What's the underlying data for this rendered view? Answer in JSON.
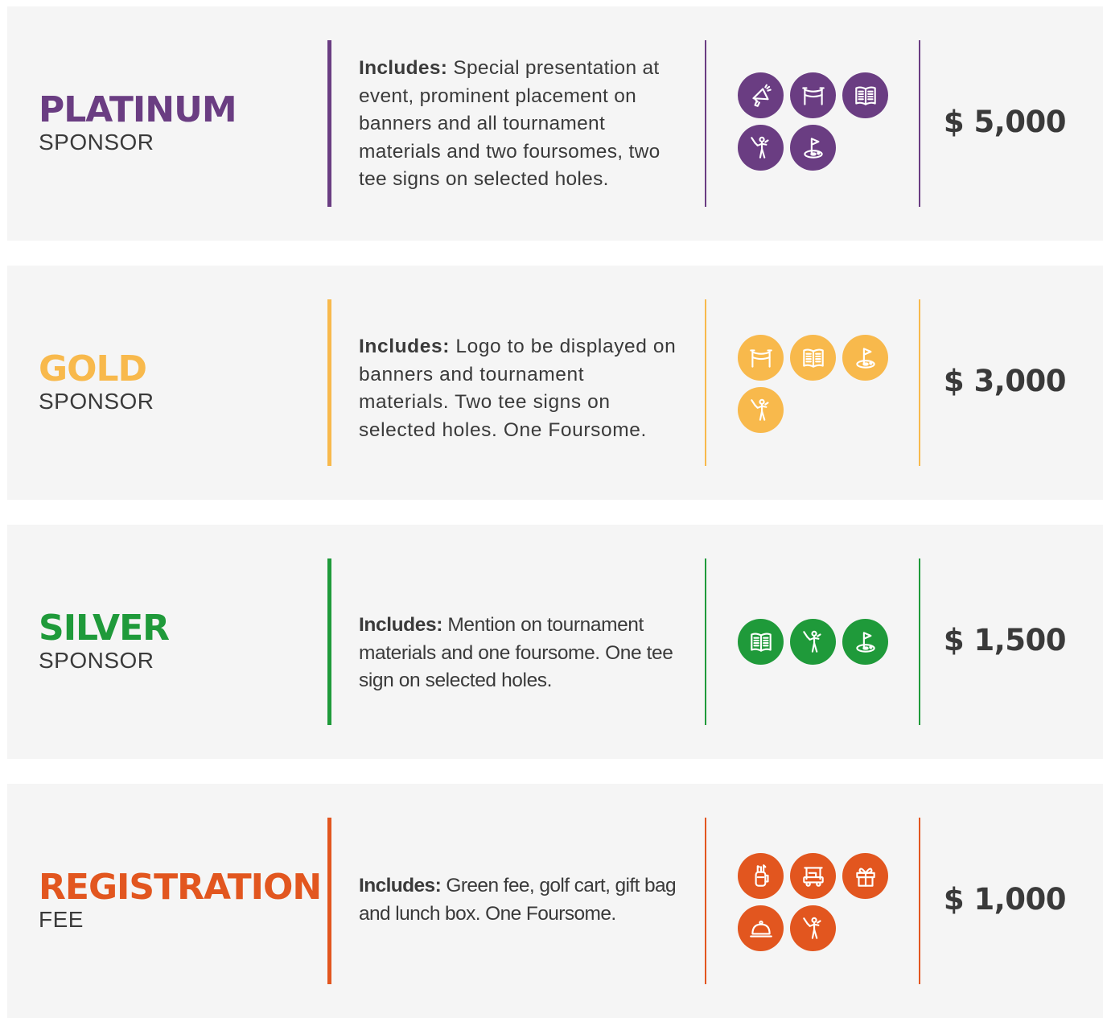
{
  "tiers": [
    {
      "name": "PLATINUM",
      "subtitle": "SPONSOR",
      "color": "#6a3d82",
      "includes_label": "Includes:",
      "description": "Special presentation at event, prominent placement on banners and all  tournament materials and two foursomes, two tee signs on selected holes.",
      "icons": [
        "megaphone-icon",
        "banner-icon",
        "brochure-icon",
        "golfer-icon",
        "golf-hole-icon"
      ],
      "price": "$ 5,000"
    },
    {
      "name": "GOLD",
      "subtitle": "SPONSOR",
      "color": "#f8b94c",
      "includes_label": "Includes:",
      "description": "Logo to be displayed on banners and tournament materials. Two tee signs on selected holes. One Foursome.",
      "icons": [
        "banner-icon",
        "brochure-icon",
        "golf-hole-icon",
        "golfer-icon"
      ],
      "price": "$ 3,000"
    },
    {
      "name": "SILVER",
      "subtitle": "SPONSOR",
      "color": "#1f9a3a",
      "includes_label": "Includes:",
      "description": "Mention on tournament materials and one foursome. One tee sign on selected holes.",
      "icons": [
        "brochure-icon",
        "golfer-icon",
        "golf-hole-icon"
      ],
      "price": "$ 1,500"
    },
    {
      "name": "REGISTRATION",
      "subtitle": "FEE",
      "color": "#e2561f",
      "includes_label": "Includes:",
      "description": "Green fee, golf cart, gift bag and lunch box. One Foursome.",
      "icons": [
        "golf-bag-icon",
        "golf-cart-icon",
        "gift-icon",
        "lunch-cloche-icon",
        "golfer-icon"
      ],
      "price": "$ 1,000"
    }
  ]
}
